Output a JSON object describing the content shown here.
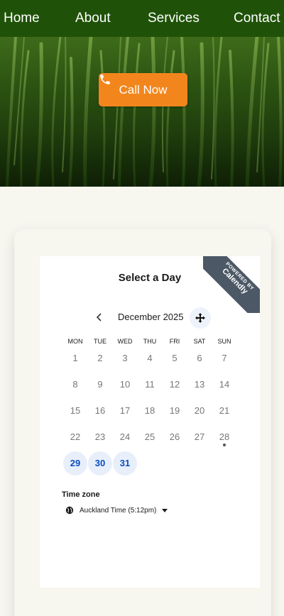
{
  "nav": {
    "items": [
      {
        "label": "Home"
      },
      {
        "label": "About"
      },
      {
        "label": "Services"
      },
      {
        "label": "Contact"
      }
    ],
    "bg_color": "#1f5208"
  },
  "hero": {
    "cta_label": "Call Now",
    "cta_icon": "phone-icon",
    "cta_color": "#f2861d"
  },
  "scheduler": {
    "ribbon_small": "POWERED BY",
    "ribbon_big": "Calendly",
    "title": "Select a Day",
    "month": "December 2025",
    "weekdays": [
      "MON",
      "TUE",
      "WED",
      "THU",
      "FRI",
      "SAT",
      "SUN"
    ],
    "weeks": [
      [
        "1",
        "2",
        "3",
        "4",
        "5",
        "6",
        "7"
      ],
      [
        "8",
        "9",
        "10",
        "11",
        "12",
        "13",
        "14"
      ],
      [
        "15",
        "16",
        "17",
        "18",
        "19",
        "20",
        "21"
      ],
      [
        "22",
        "23",
        "24",
        "25",
        "26",
        "27",
        "28"
      ],
      [
        "29",
        "30",
        "31"
      ]
    ],
    "available_days": [
      "29",
      "30",
      "31"
    ],
    "today": "28",
    "timezone_label": "Time zone",
    "timezone_value": "Auckland Time (5:12pm)",
    "available_color": "#0b4ec2"
  }
}
